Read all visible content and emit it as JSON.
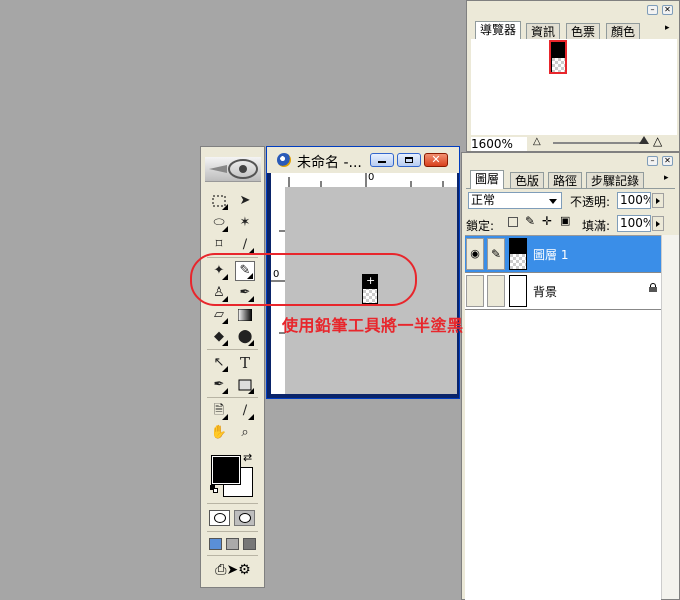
{
  "navigator": {
    "tabs": [
      {
        "label": "導覽器",
        "active": true
      },
      {
        "label": "資訊",
        "active": false
      },
      {
        "label": "色票",
        "active": false
      },
      {
        "label": "顏色",
        "active": false
      }
    ],
    "zoom": "1600%",
    "frame_color": "#e8262c"
  },
  "document": {
    "title": "未命名 -...",
    "ruler_top_label": "0",
    "ruler_left_label": "0"
  },
  "layers_panel": {
    "tabs": [
      {
        "label": "圖層",
        "active": true
      },
      {
        "label": "色版",
        "active": false
      },
      {
        "label": "路徑",
        "active": false
      },
      {
        "label": "步驟記錄",
        "active": false
      }
    ],
    "blend_mode": "正常",
    "opacity_label": "不透明:",
    "opacity_value": "100%",
    "lock_label": "鎖定:",
    "fill_label": "填滿:",
    "fill_value": "100%",
    "layers": [
      {
        "name": "圖層 1",
        "selected": true
      },
      {
        "name": "背景",
        "selected": false
      }
    ],
    "selection_color": "#3a8ee8"
  },
  "annotation": {
    "text": "使用鉛筆工具將一半塗黑",
    "color": "#e8262c"
  },
  "colors": {
    "foreground": "#000000",
    "background": "#ffffff"
  }
}
